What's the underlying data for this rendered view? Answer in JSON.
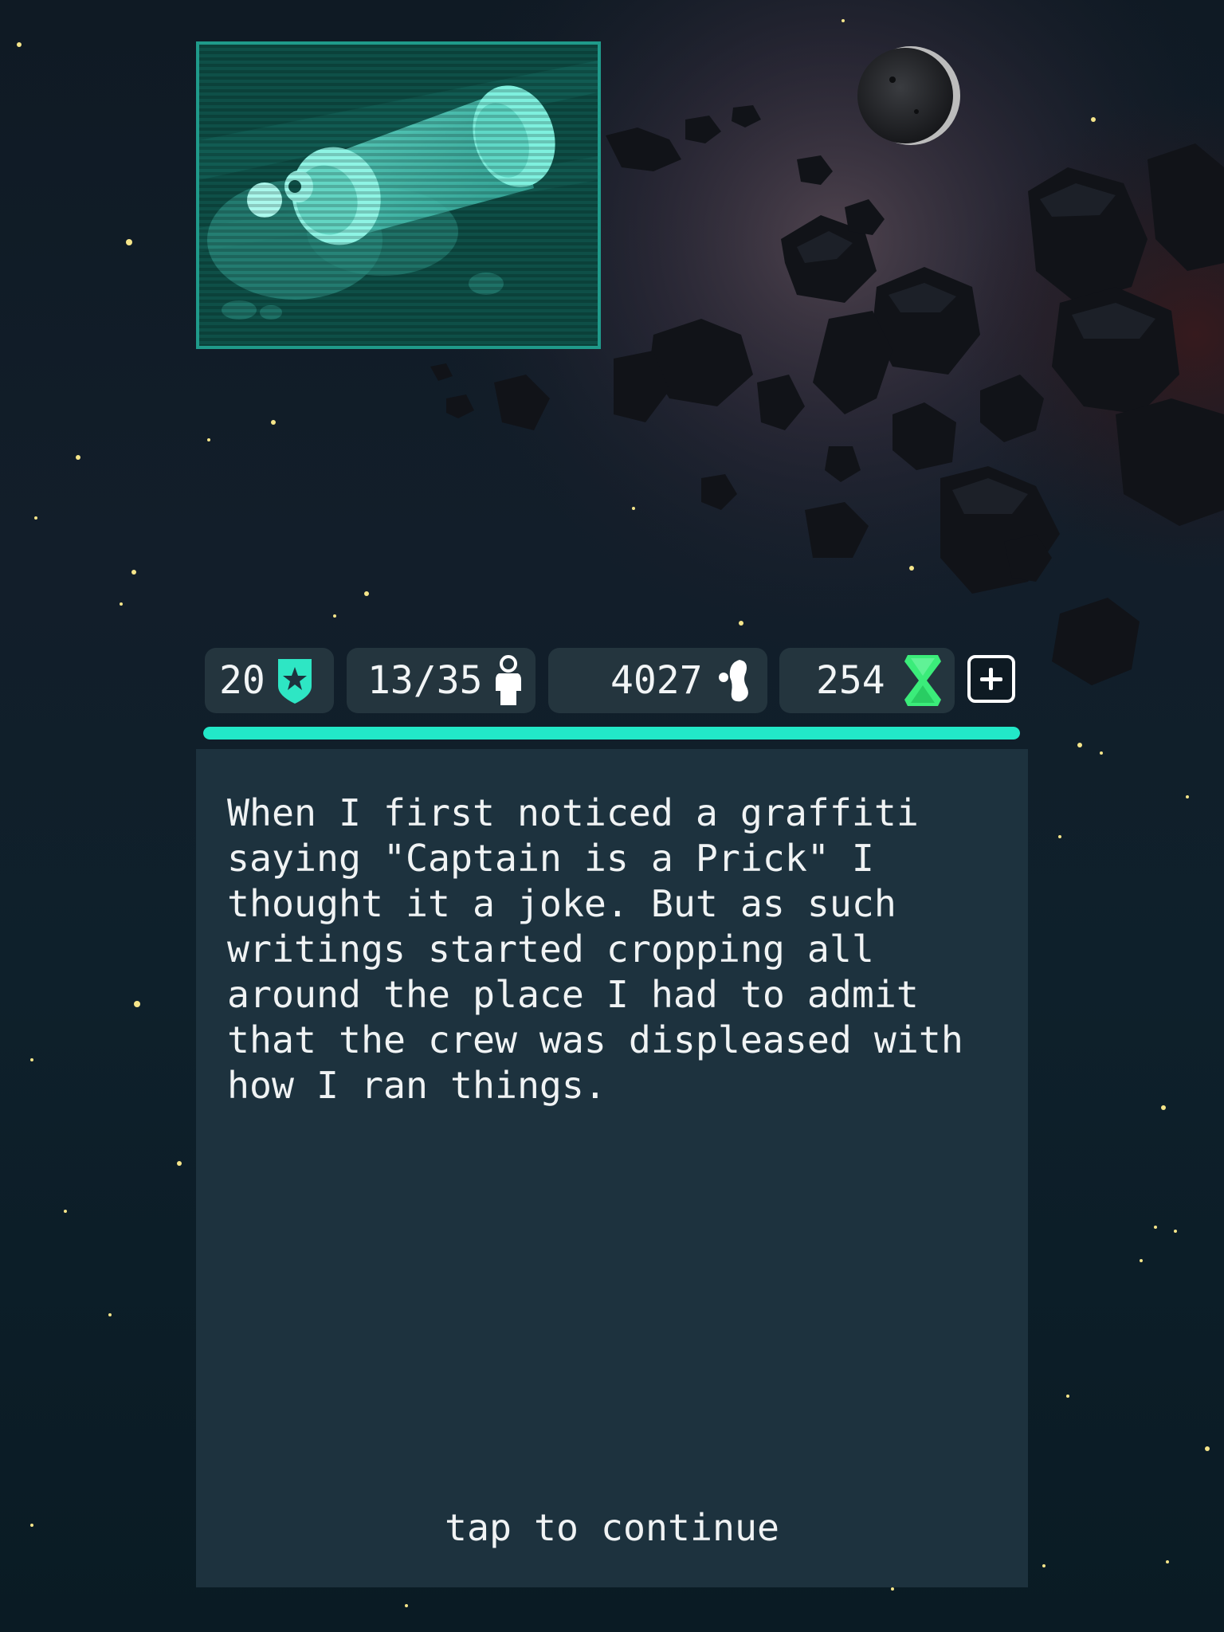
{
  "portrait": {
    "icon": "spray-paint-can-icon"
  },
  "stats": {
    "rank": {
      "value": "20",
      "icon": "star-shield-icon",
      "color": "#2ee6c4"
    },
    "crew": {
      "value": "13/35",
      "icon": "crew-member-icon"
    },
    "ore": {
      "value": "4027",
      "icon": "ore-blob-icon"
    },
    "gems": {
      "value": "254",
      "icon": "green-gem-icon",
      "color": "#3bec7a"
    },
    "add_icon": "plus-icon"
  },
  "progress": {
    "fraction": 1.0,
    "color": "#22e8c8"
  },
  "dialog": {
    "text": "When I first noticed a graffiti\nsaying \"Captain is a Prick\" I\nthought it a joke. But as such\nwritings started cropping all\naround the place I had to admit\nthat the crew was displeased with\nhow I ran things.",
    "continue_label": "tap to continue"
  }
}
